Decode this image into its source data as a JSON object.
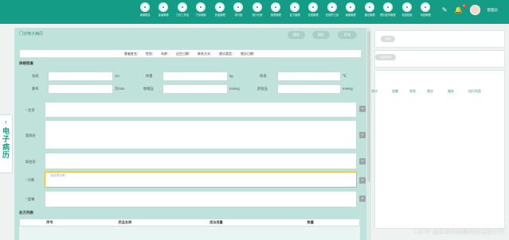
{
  "topbar": {
    "nav_items": [
      "病例报告",
      "患者管理",
      "门诊工作站",
      "门诊病案",
      "药品管理",
      "排行班",
      "统计分析",
      "报表管理",
      "处方管理",
      "住院管理",
      "住院护士站",
      "病案管理",
      "随访管理",
      "预约挂号管理",
      "检查检验",
      "系统管理"
    ],
    "notification_count": "6",
    "username": "管理员"
  },
  "side_tab": {
    "label": "电子病历"
  },
  "panel": {
    "title": "门诊电子病历",
    "buttons": [
      "保存",
      "保存",
      "打印"
    ],
    "patient_info": [
      "患者姓名：",
      "性别：",
      "年龄：",
      "出生日期：",
      "联系方式：",
      "就诊类型：",
      "就诊日期："
    ],
    "vitals_title": "体格检查",
    "vitals": [
      {
        "label": "身高",
        "unit": "cm"
      },
      {
        "label": "体重",
        "unit": "kg"
      },
      {
        "label": "体温",
        "unit": "℃"
      },
      {
        "label": "脉率",
        "unit": "次/min"
      },
      {
        "label": "收缩压",
        "unit": "mmHg"
      },
      {
        "label": "舒张压",
        "unit": "mmHg"
      }
    ],
    "fields": [
      {
        "label": "主诉",
        "required": true,
        "placeholder": ""
      },
      {
        "label": "现病史",
        "required": false,
        "placeholder": ""
      },
      {
        "label": "既往史",
        "required": false,
        "placeholder": ""
      },
      {
        "label": "诊断",
        "required": true,
        "placeholder": "请选择诊断"
      },
      {
        "label": "医嘱",
        "required": true,
        "placeholder": ""
      }
    ],
    "table_title": "处方列表",
    "table_headers": [
      "序号",
      "药品名称",
      "用法用量",
      "数量"
    ]
  },
  "background": {
    "pills": [
      "待收",
      "已收待诊"
    ],
    "columns": [
      "合计",
      "金额",
      "状态",
      "就诊",
      "服务",
      "执行科室"
    ]
  },
  "watermark": "CSDN @深圳市快鲢科技有限公司"
}
